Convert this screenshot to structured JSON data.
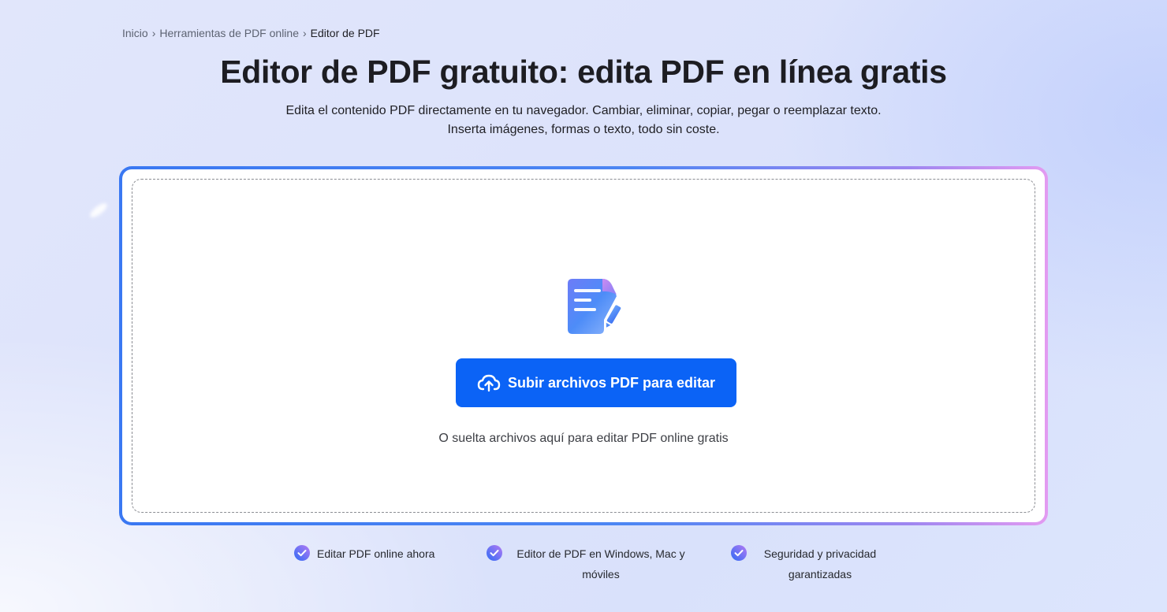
{
  "breadcrumb": {
    "items": [
      "Inicio",
      "Herramientas de PDF online"
    ],
    "current": "Editor de PDF",
    "separator": "›"
  },
  "hero": {
    "title": "Editor de PDF gratuito: edita PDF en línea gratis",
    "subtitle_line1": "Edita el contenido PDF directamente en tu navegador. Cambiar, eliminar, copiar, pegar o reemplazar texto.",
    "subtitle_line2": "Inserta imágenes, formas o texto, todo sin coste."
  },
  "upload": {
    "icon": "edit-document-icon",
    "button_label": "Subir archivos PDF para editar",
    "button_icon": "cloud-upload-icon",
    "drop_hint": "O suelta archivos aquí para editar PDF online gratis"
  },
  "features": [
    {
      "label": "Editar PDF online ahora",
      "icon": "check-circle-icon"
    },
    {
      "label": "Editor de PDF en Windows, Mac y móviles",
      "icon": "check-circle-icon"
    },
    {
      "label": "Seguridad y privacidad garantizadas",
      "icon": "check-circle-icon"
    }
  ],
  "colors": {
    "accent": "#0b63f6",
    "card_border_start": "#3a78f2",
    "card_border_end": "#e39bf1",
    "check_start": "#2f6cf5",
    "check_end": "#b47af3"
  }
}
